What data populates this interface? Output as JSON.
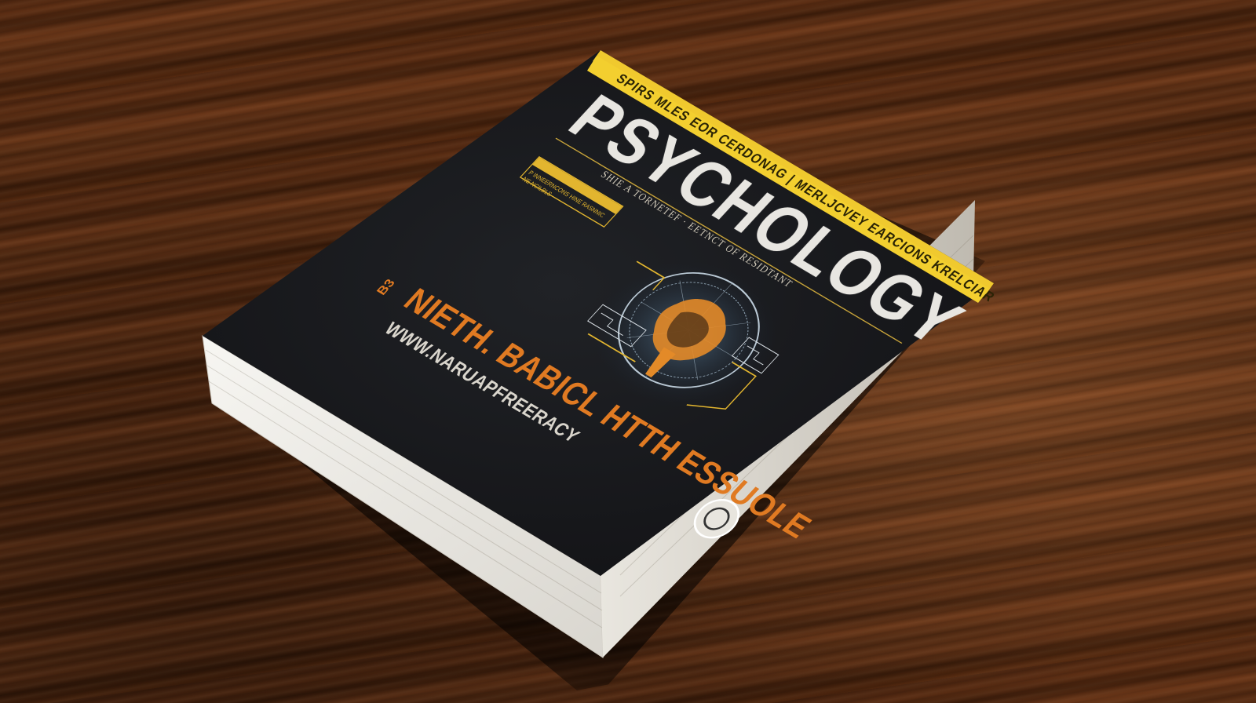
{
  "scene": {
    "description_colors": {
      "wood_dark": "#3f1e0b",
      "wood_light": "#6a3618",
      "cover_black": "#17171a",
      "cover_band_yellow": "#f0c92e",
      "accent_orange": "#e07a22",
      "accent_gold": "#e2b52f",
      "page_edge": "#f2f0ea"
    }
  },
  "book": {
    "top_band_text": "SPIRS MLES EOR CERDONAG | MERLJCVEY EARCIONS KRELCIAR",
    "title": "PSYCHOLOGY",
    "tagline": "SHIE A TORNETEF · EETNCT OF RESIDTANT",
    "label_box_text": "P INNEERNCONS HINE RASNNIC NE NCILBLS",
    "author": "NIETH. BABICL HTTH ESSUOLE",
    "website": "WWW.NARUAPFREERACY",
    "side_badge": "B3",
    "icons": {
      "brain": "brain-illustration-icon",
      "seal": "publisher-seal-icon",
      "circuit": "circuit-diagram-icon"
    }
  }
}
